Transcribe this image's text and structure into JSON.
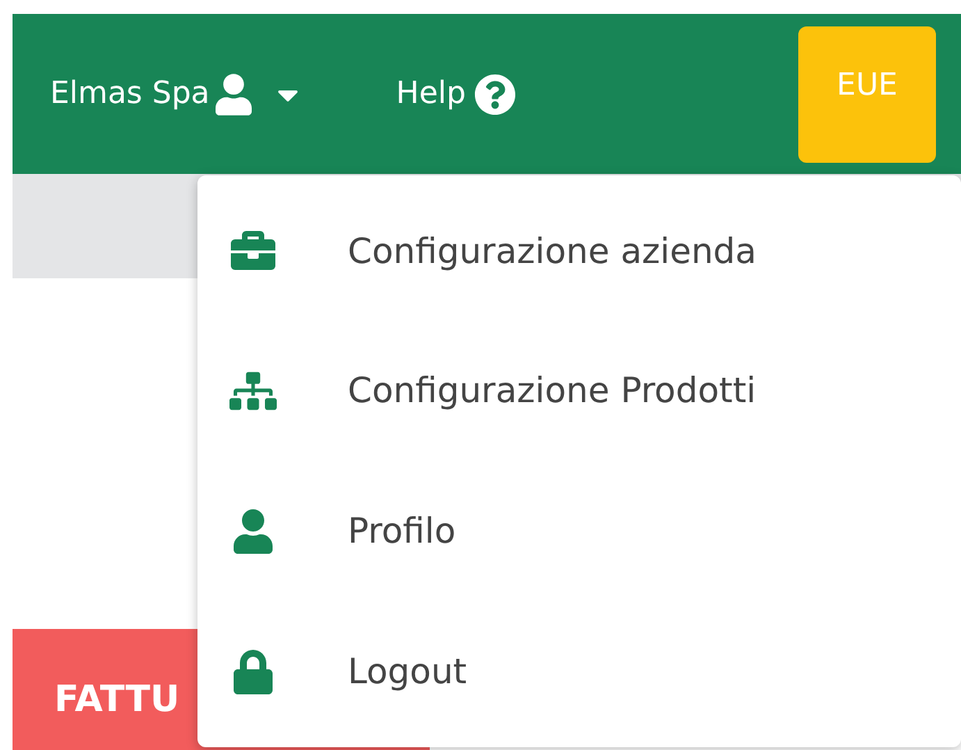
{
  "header": {
    "company": "Elmas Spa",
    "user_menu_expanded": true,
    "help": "Help",
    "badge": "EUE"
  },
  "action_button": "FATTU",
  "user_menu": [
    {
      "label": "Configurazione azienda"
    },
    {
      "label": "Configurazione Prodotti"
    },
    {
      "label": "Profilo"
    },
    {
      "label": "Logout"
    }
  ]
}
